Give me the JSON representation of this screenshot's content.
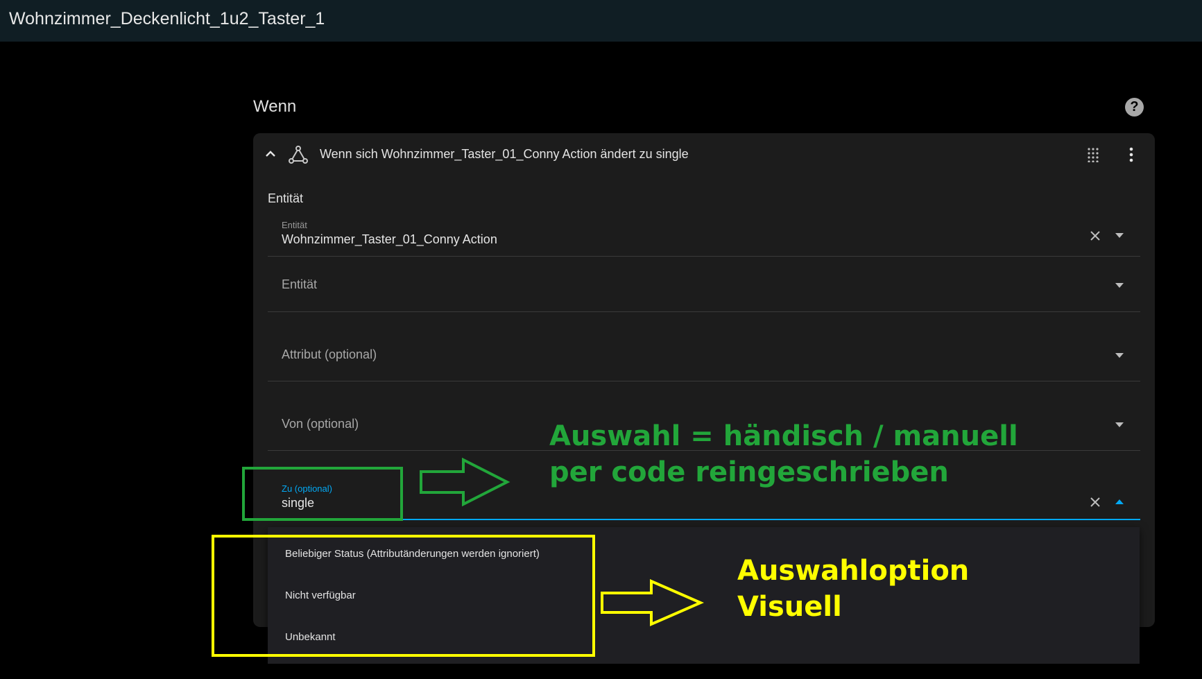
{
  "window": {
    "title": "Wohnzimmer_Deckenlicht_1u2_Taster_1"
  },
  "section": {
    "title": "Wenn",
    "help_glyph": "?"
  },
  "trigger": {
    "heading": "Wenn sich Wohnzimmer_Taster_01_Conny Action ändert zu single",
    "entity_section_label": "Entität",
    "fields": {
      "entity_selected": {
        "label": "Entität",
        "value": "Wohnzimmer_Taster_01_Conny Action"
      },
      "entity_empty": {
        "placeholder": "Entität"
      },
      "attribute": {
        "placeholder": "Attribut (optional)"
      },
      "from": {
        "placeholder": "Von (optional)"
      },
      "to": {
        "label": "Zu (optional)",
        "value": "single"
      }
    },
    "dropdown_options": [
      "Beliebiger Status (Attributänderungen werden ignoriert)",
      "Nicht verfügbar",
      "Unbekannt"
    ]
  },
  "annotations": {
    "green_text_line1": "Auswahl = händisch / manuell",
    "green_text_line2": "per code reingeschrieben",
    "yellow_text_line1": "Auswahloption",
    "yellow_text_line2": "Visuell"
  },
  "colors": {
    "accent": "#03a9f4",
    "annotation_green": "#22a63a",
    "annotation_yellow": "#ffff00"
  },
  "icons": {
    "collapse": "chevron-up-icon",
    "trigger": "state-graph-icon",
    "drag": "drag-handle-icon",
    "menu": "dots-vertical-icon",
    "clear": "close-icon",
    "expand": "chevron-down-icon",
    "help": "help-circle-icon"
  }
}
